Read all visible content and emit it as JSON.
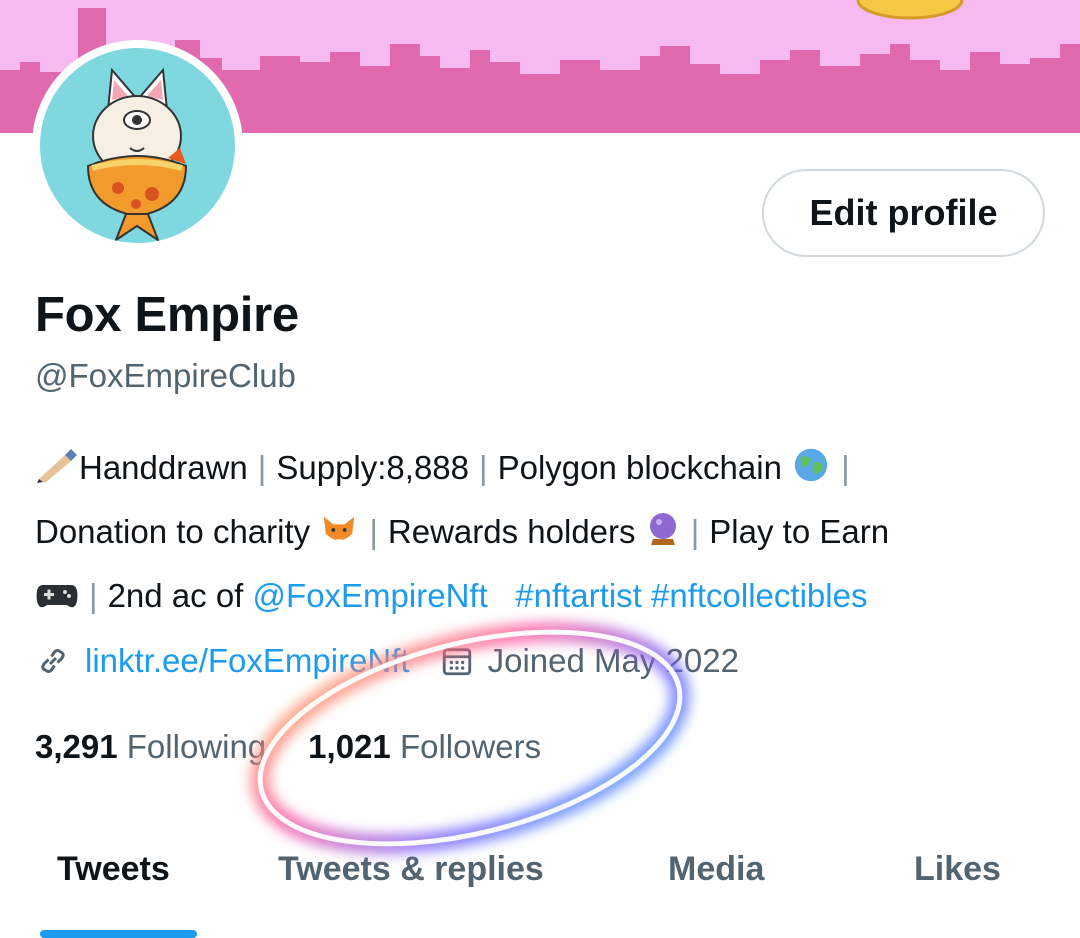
{
  "colors": {
    "banner": "#f6b9f0",
    "skyline": "#e06aad",
    "accent": "#1d9bf0",
    "text": "#0f1419",
    "secondary": "#536471"
  },
  "header": {
    "edit_profile_label": "Edit profile"
  },
  "profile": {
    "name": "Fox Empire",
    "handle": "@FoxEmpireClub",
    "bio": {
      "line1": {
        "a": "Handdrawn",
        "b": "Supply:8,888",
        "c": "Polygon blockchain"
      },
      "line2": {
        "a": "Donation to charity",
        "b": "Rewards holders",
        "c": "Play to Earn"
      },
      "line3": {
        "a": "2nd ac of ",
        "mention": "@FoxEmpireNft",
        "tag1": "#nftartist",
        "tag2": "#nftcollectibles"
      }
    },
    "link_text": "linktr.ee/FoxEmpireNft",
    "joined_text": "Joined May 2022",
    "icons": [
      "link-icon",
      "calendar-icon",
      "pen-emoji-icon",
      "globe-emoji-icon",
      "fox-emoji-icon",
      "crystal-ball-emoji-icon",
      "gamepad-emoji-icon"
    ]
  },
  "stats": {
    "following_count": "3,291",
    "following_label": "Following",
    "followers_count": "1,021",
    "followers_label": "Followers"
  },
  "tabs": [
    {
      "label": "Tweets",
      "active": true
    },
    {
      "label": "Tweets & replies",
      "active": false
    },
    {
      "label": "Media",
      "active": false
    },
    {
      "label": "Likes",
      "active": false
    }
  ]
}
